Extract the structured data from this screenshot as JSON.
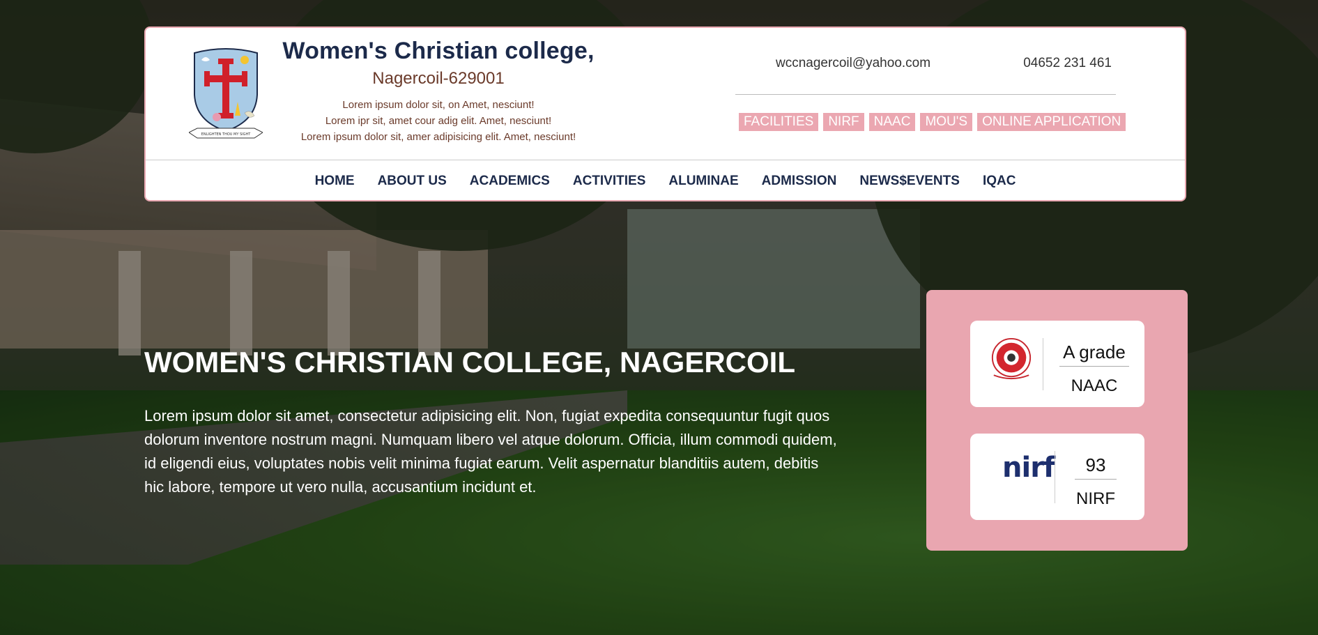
{
  "brand": {
    "name": "Women's Christian college,",
    "location": "Nagercoil-629001",
    "tagline_lines": [
      "Lorem ipsum dolor sit, on Amet, nesciunt!",
      "Lorem ipr sit, amet cour adig elit. Amet, nesciunt!",
      "Lorem ipsum dolor sit, amer adipisicing elit. Amet, nesciunt!"
    ],
    "logo_icon": "college-crest-icon",
    "motto_ribbon_text": "ENLIGHTEN THOU MY SIGHT"
  },
  "contact": {
    "email": "wccnagercoil@yahoo.com",
    "phone": "04652 231 461"
  },
  "quick_links": [
    "FACILITIES",
    "NIRF",
    "NAAC",
    "MOU'S",
    "ONLINE APPLICATION"
  ],
  "nav": [
    "HOME",
    "ABOUT US",
    "ACADEMICS",
    "ACTIVITIES",
    "ALUMINAE",
    "ADMISSION",
    "NEWS$EVENTS",
    "IQAC"
  ],
  "hero": {
    "title": "WOMEN'S CHRISTIAN COLLEGE, NAGERCOIL",
    "body": "Lorem ipsum dolor sit amet, consectetur adipisicing elit. Non, fugiat expedita consequuntur fugit quos dolorum inventore nostrum magni. Numquam libero vel atque dolorum. Officia, illum commodi quidem, id eligendi eius, voluptates nobis velit minima fugiat earum. Velit aspernatur blanditiis autem, debitis hic labore, tempore ut vero nulla, accusantium incidunt et."
  },
  "accreditations": [
    {
      "value": "A grade",
      "label": "NAAC",
      "icon": "naac-seal-icon"
    },
    {
      "value": "93",
      "label": "NIRF",
      "icon": "nirf-logo-icon",
      "logo_text": "nirf"
    }
  ],
  "colors": {
    "accent_pink": "#eba7b1",
    "navy": "#1c2a4a",
    "brown_text": "#6a3a2a"
  }
}
